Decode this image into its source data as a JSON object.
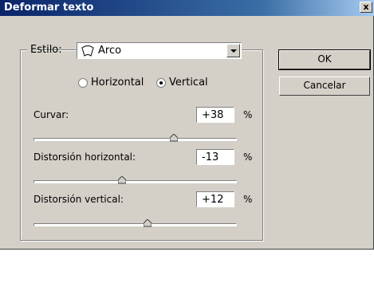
{
  "window": {
    "title": "Deformar texto",
    "close_glyph": "x"
  },
  "style": {
    "label": "Estilo:",
    "value": "Arco",
    "icon": "arc-warp-icon"
  },
  "orientation": {
    "horizontal_label": "Horizontal",
    "vertical_label": "Vertical",
    "selected": "Vertical"
  },
  "sliders": [
    {
      "label": "Curvar:",
      "value": "+38",
      "unit": "%",
      "level": 0.69
    },
    {
      "label": "Distorsión horizontal:",
      "value": "-13",
      "unit": "%",
      "level": 0.435
    },
    {
      "label": "Distorsión vertical:",
      "value": "+12",
      "unit": "%",
      "level": 0.56
    }
  ],
  "buttons": {
    "ok": "OK",
    "cancel": "Cancelar"
  }
}
